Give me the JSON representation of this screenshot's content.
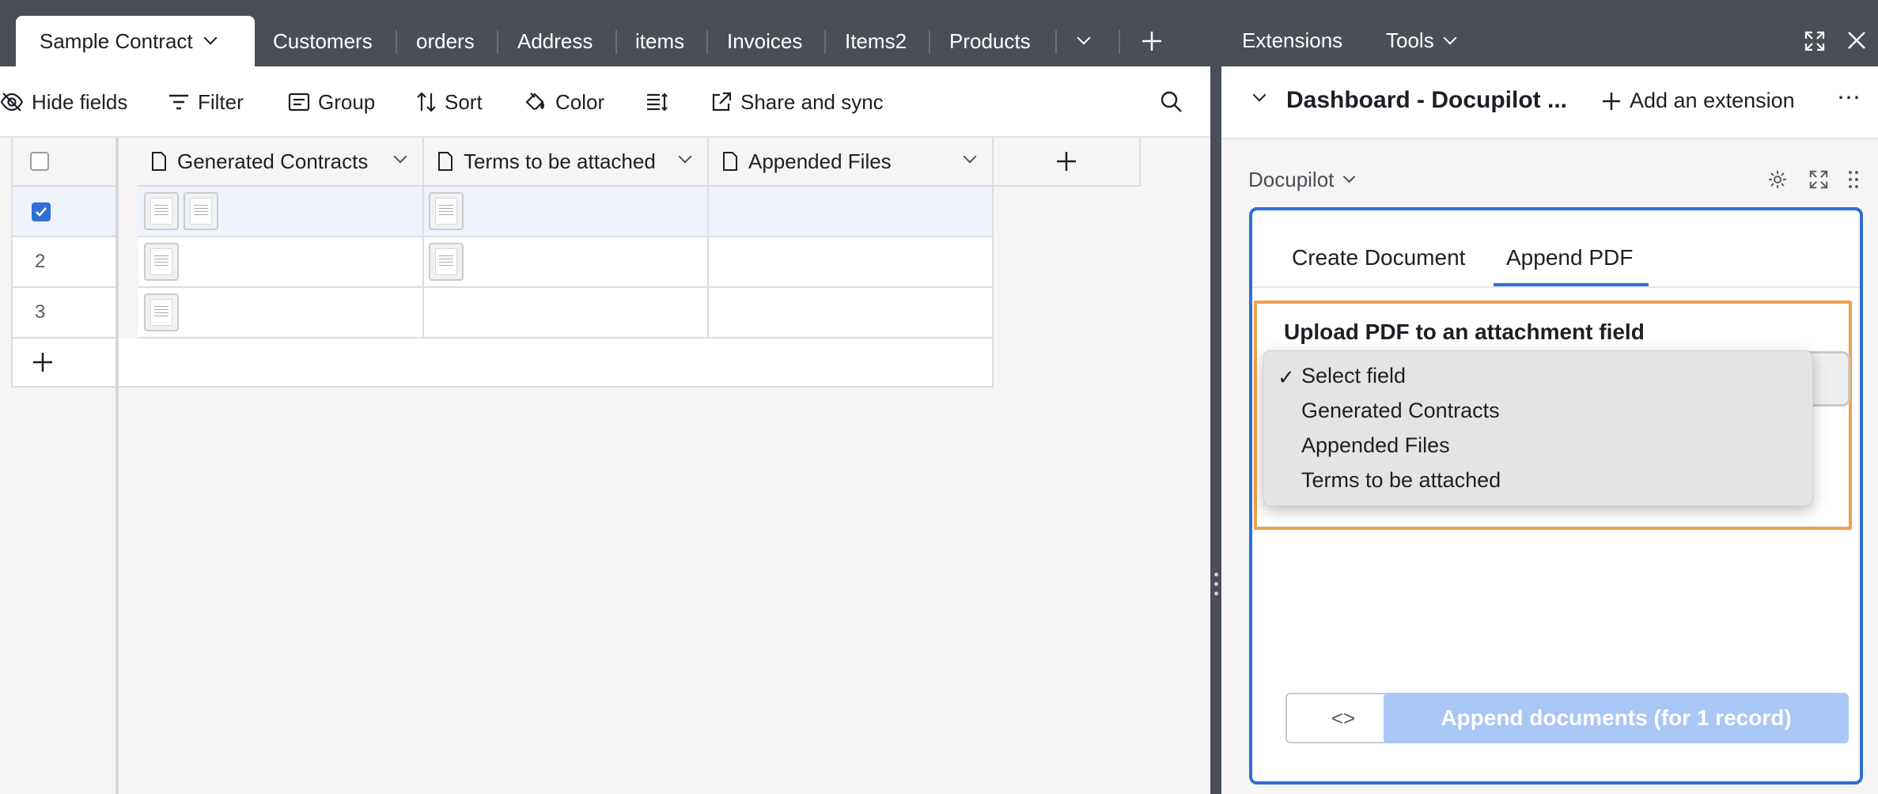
{
  "tabs": {
    "active": "Sample Contract",
    "items": [
      "Customers",
      "orders",
      "Address",
      "items",
      "Invoices",
      "Items2",
      "Products"
    ]
  },
  "toolbar": {
    "hide_fields": "Hide fields",
    "filter": "Filter",
    "group": "Group",
    "sort": "Sort",
    "color": "Color",
    "share": "Share and sync"
  },
  "grid": {
    "columns": [
      "Generated Contracts",
      "Terms to be attached",
      "Appended Files"
    ],
    "rows": [
      {
        "num": "",
        "checked": true,
        "generated_thumbs": 2,
        "terms_thumbs": 1
      },
      {
        "num": "2",
        "checked": false,
        "generated_thumbs": 1,
        "terms_thumbs": 1
      },
      {
        "num": "3",
        "checked": false,
        "generated_thumbs": 1,
        "terms_thumbs": 0
      }
    ]
  },
  "right_top": {
    "extensions": "Extensions",
    "tools": "Tools"
  },
  "dashboard": {
    "title": "Dashboard - Docupilot ...",
    "add_extension": "Add an extension"
  },
  "extension": {
    "name": "Docupilot",
    "tabs": [
      "Create Document",
      "Append PDF"
    ],
    "active_tab": "Append PDF",
    "upload_title": "Upload PDF to an attachment field",
    "code_button": "<>",
    "append_button": "Append documents (for 1 record)"
  },
  "dropdown": {
    "selected": "Select field",
    "options": [
      "Select field",
      "Generated Contracts",
      "Appended Files",
      "Terms to be attached"
    ]
  },
  "colors": {
    "accent": "#2f6ed6",
    "highlight_box": "#f0a04b",
    "append_button": "#a9c7f4",
    "tabbar": "#4a4f57"
  }
}
